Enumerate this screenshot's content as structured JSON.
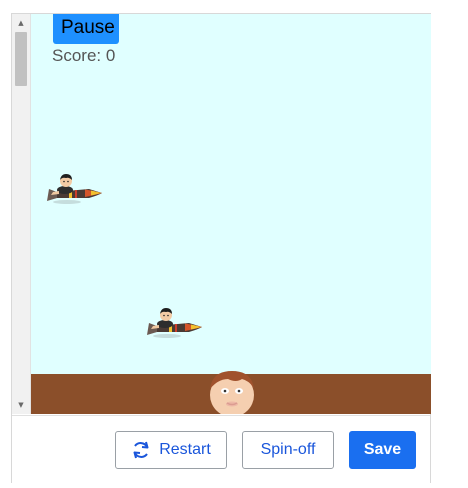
{
  "game": {
    "pause_label": "Pause",
    "score_text": "Score: 0",
    "colors": {
      "sky": "#e0ffff",
      "ground": "#8b4f2a",
      "pause_button": "#1e90ff"
    },
    "sprites": [
      {
        "name": "rocket-rider",
        "icon": "rocket-rider-icon"
      },
      {
        "name": "rocket-rider",
        "icon": "rocket-rider-icon"
      },
      {
        "name": "player-head",
        "icon": "player-head-icon"
      }
    ]
  },
  "scrollbar": {
    "up_icon": "scroll-up-arrow-icon",
    "down_icon": "scroll-down-arrow-icon"
  },
  "footer": {
    "restart_label": "Restart",
    "restart_icon": "restart-icon",
    "spinoff_label": "Spin-off",
    "save_label": "Save",
    "colors": {
      "accent": "#1a56db",
      "save_bg": "#1a6ff0"
    }
  }
}
